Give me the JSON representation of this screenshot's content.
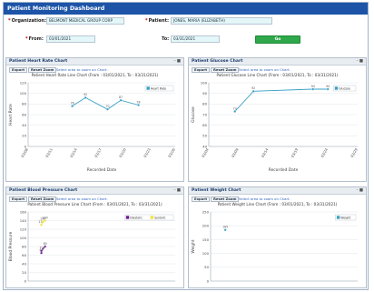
{
  "header": {
    "title": "Patient Monitoring Dashboard"
  },
  "filters": {
    "organization_label": "Organization:",
    "organization_value": "BELMONT MEDICAL GROUP CORP",
    "patient_label": "Patient:",
    "patient_value": "JONES, MARIA (ELIZABETH)",
    "from_label": "From:",
    "from_value": "03/01/2021",
    "to_label": "To:",
    "to_value": "03/31/2021",
    "go_label": "Go"
  },
  "toolbar": {
    "export_label": "Export",
    "reset_zoom_label": "Reset Zoom",
    "hint": "Select area to zoom on Chart."
  },
  "panels": {
    "heart": {
      "title": "Patient Heart Rate Chart",
      "subtitle": "Patient Heart Rate Line Chart (From : 03/01/2021, To : 03/31/2021)"
    },
    "glucose": {
      "title": "Patient Glucose Chart",
      "subtitle": "Patient Glucose Line Chart (From : 03/01/2021, To : 03/31/2021)"
    },
    "bp": {
      "title": "Patient Blood Pressure Chart",
      "subtitle": "Patient Blood Pressure Line Chart (From : 03/01/2021, To : 03/31/2021)"
    },
    "weight": {
      "title": "Patient Weight Chart",
      "subtitle": "Patient Weight Line Chart (From : 03/01/2021, To : 03/31/2021)"
    }
  },
  "chart_data": [
    {
      "id": "heart",
      "type": "line",
      "ylabel": "Heart Rate",
      "xlabel": "Recorded Date",
      "ylim": [
        0,
        120
      ],
      "yticks": [
        0,
        20,
        40,
        60,
        80,
        100,
        120
      ],
      "xticks": [
        "03/08",
        "03/11",
        "03/14",
        "03/17",
        "03/20",
        "03/23",
        "03/26"
      ],
      "legend_position": "top-right",
      "series": [
        {
          "name": "Heart Rate",
          "color": "#3aa0c4",
          "points": [
            {
              "x": 3.0,
              "y": 76
            },
            {
              "x": 3.9,
              "y": 92
            },
            {
              "x": 5.4,
              "y": 70
            },
            {
              "x": 6.3,
              "y": 87
            },
            {
              "x": 7.5,
              "y": 78
            }
          ]
        }
      ]
    },
    {
      "id": "glucose",
      "type": "line",
      "ylabel": "Glucose",
      "xlabel": "Recorded Date",
      "ylim": [
        40,
        100
      ],
      "yticks": [
        40,
        50,
        60,
        70,
        80,
        90,
        100
      ],
      "xticks": [
        "03/04",
        "03/09",
        "03/14",
        "03/19",
        "03/24",
        "03/29"
      ],
      "legend_position": "top-right",
      "series": [
        {
          "name": "Glucose",
          "color": "#3aa0c4",
          "points": [
            {
              "x": 1.05,
              "y": 73
            },
            {
              "x": 1.8,
              "y": 92
            },
            {
              "x": 4.2,
              "y": 94
            },
            {
              "x": 4.8,
              "y": 94
            }
          ]
        }
      ]
    },
    {
      "id": "bp",
      "type": "scatter",
      "ylabel": "Blood Pressure",
      "xlabel": "",
      "ylim": [
        0,
        160
      ],
      "yticks": [
        0,
        20,
        40,
        60,
        80,
        100,
        120,
        140,
        160
      ],
      "xticks": [],
      "legend_position": "top-right",
      "series": [
        {
          "name": "Diastolic",
          "color": "#6a1a8a",
          "points": [
            {
              "x": 0.9,
              "y": 65
            },
            {
              "x": 0.9,
              "y": 70
            },
            {
              "x": 1.15,
              "y": 80
            }
          ]
        },
        {
          "name": "Systolic",
          "color": "#f2e03c",
          "points": [
            {
              "x": 0.9,
              "y": 130
            },
            {
              "x": 1.0,
              "y": 138
            },
            {
              "x": 1.15,
              "y": 140
            }
          ]
        }
      ]
    },
    {
      "id": "weight",
      "type": "scatter",
      "ylabel": "Weight",
      "xlabel": "",
      "ylim": [
        0,
        250
      ],
      "yticks": [
        0,
        50,
        100,
        150,
        200,
        250
      ],
      "xticks": [],
      "legend_position": "top-right",
      "series": [
        {
          "name": "Weight",
          "color": "#3aa0c4",
          "points": [
            {
              "x": 1.0,
              "y": 185
            }
          ]
        }
      ]
    }
  ]
}
